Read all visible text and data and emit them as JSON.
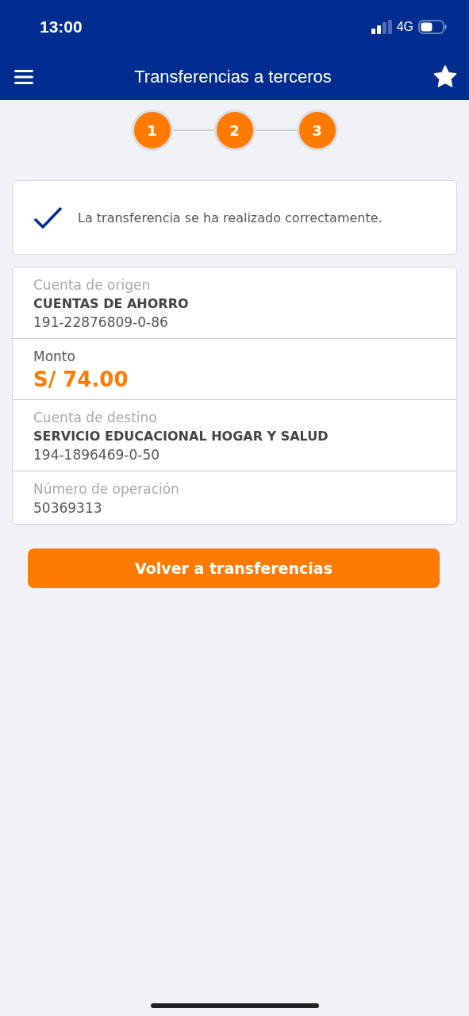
{
  "status_bar": {
    "time": "13:00",
    "network": "4G"
  },
  "header": {
    "title": "Transferencias a terceros"
  },
  "steps": [
    {
      "label": "1",
      "completed": true
    },
    {
      "label": "2",
      "completed": true
    },
    {
      "label": "3",
      "completed": true
    }
  ],
  "message": {
    "text": "La transferencia se ha realizado correctamente."
  },
  "details": [
    {
      "kind": "account",
      "label": "Cuenta de origen",
      "name": "CUENTAS DE AHORRO",
      "number": "191-22876809-0-86"
    },
    {
      "kind": "amount",
      "label": "Monto",
      "value": "S/ 74.00"
    },
    {
      "kind": "account",
      "label": "Cuenta de destino",
      "name": "SERVICIO EDUCACIONAL HOGAR Y SALUD",
      "number": "194-1896469-0-50"
    },
    {
      "kind": "plain",
      "label": "Número de operación",
      "value": "50369313"
    }
  ],
  "button": {
    "label": "Volver a transferencias"
  }
}
